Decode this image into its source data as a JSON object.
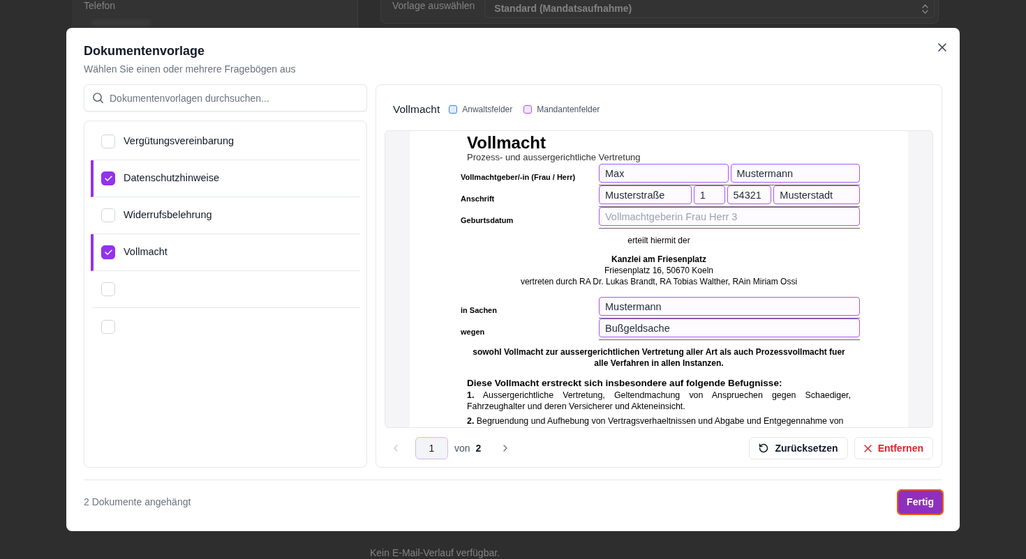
{
  "background": {
    "contact_label": "Telefon",
    "template_label": "Vorlage auswählen",
    "template_value": "Standard (Mandatsaufnahme)",
    "email_empty": "Kein E-Mail-Verlauf verfügbar."
  },
  "dialog": {
    "title": "Dokumentenvorlage",
    "subtitle": "Wählen Sie einen oder mehrere Fragebögen aus"
  },
  "search": {
    "placeholder": "Dokumentenvorlagen durchsuchen..."
  },
  "templates": [
    {
      "label": "Vergütungsvereinbarung",
      "checked": false
    },
    {
      "label": "Datenschutzhinweise",
      "checked": true
    },
    {
      "label": "Widerrufsbelehrung",
      "checked": false
    },
    {
      "label": "Vollmacht",
      "checked": true
    },
    {
      "checked": false
    },
    {
      "checked": false
    }
  ],
  "preview": {
    "title": "Vollmacht",
    "legend": [
      {
        "label": "Anwaltsfelder",
        "color": "#3b82f6"
      },
      {
        "label": "Mandantenfelder",
        "color": "#a855f7"
      }
    ],
    "document": {
      "heading": "Vollmacht",
      "subheading": "Prozess- und aussergerichtliche Vertretung",
      "sections": [
        {
          "kind": "form",
          "rows": [
            {
              "label": "Vollmachtgeber/-in (Frau / Herr)",
              "fields": [
                {
                  "value": "Max"
                },
                {
                  "value": "Mustermann"
                }
              ]
            },
            {
              "label": "Anschrift",
              "fields": [
                {
                  "value": "Musterstraße"
                },
                {
                  "value": "1"
                },
                {
                  "value": "54321"
                },
                {
                  "value": "Musterstadt"
                }
              ]
            },
            {
              "label": "Geburtsdatum",
              "fields": [
                {
                  "placeholder": "Vollmachtgeberin Frau Herr 3"
                }
              ]
            }
          ]
        },
        {
          "kind": "centered",
          "lines": [
            {
              "text": "erteilt hiermit der",
              "bold": false
            }
          ]
        },
        {
          "kind": "centered",
          "lines": [
            {
              "text": "Kanzlei am Friesenplatz",
              "bold": true
            },
            {
              "text": "Friesenplatz 16, 50670 Koeln",
              "bold": false
            },
            {
              "text": "vertreten durch RA Dr. Lukas Brandt, RA Tobias Walther, RAin Miriam Ossi",
              "bold": false
            }
          ]
        },
        {
          "kind": "form",
          "rows": [
            {
              "label": "in Sachen",
              "fields": [
                {
                  "value": "Mustermann"
                }
              ]
            },
            {
              "label": "wegen",
              "fields": [
                {
                  "value": "Bußgeldsache"
                }
              ]
            }
          ]
        },
        {
          "kind": "centered",
          "lines": [
            {
              "text": "sowohl Vollmacht zur aussergerichtlichen Vertretung aller Art als auch Prozessvollmacht fuer alle Verfahren in allen Instanzen.",
              "bold": true
            }
          ]
        },
        {
          "kind": "heading",
          "text": "Diese Vollmacht erstreckt sich insbesondere auf folgende Befugnisse:"
        },
        {
          "kind": "clause",
          "text": "**1.** Aussergerichtliche Vertretung, Geltendmachung von Anspruechen gegen Schaediger, Fahrzeughalter und deren Versicherer und Akteneinsicht."
        },
        {
          "kind": "clause",
          "text": "**2.** Begruendung und Aufhebung von Vertragsverhaeltnissen und Abgabe und Entgegennahme von"
        }
      ]
    },
    "pager": {
      "prev": {
        "disabled": true
      },
      "page": "1",
      "of_label": "von",
      "total": "2",
      "next": {
        "disabled": false
      }
    },
    "actions": [
      {
        "kind": "reset",
        "label": "Zurücksetzen"
      },
      {
        "kind": "remove",
        "label": "Entfernen"
      }
    ]
  },
  "footer": {
    "status": "2 Dokumente angehängt",
    "done_button": {
      "label": "Fertig",
      "focused": true
    }
  }
}
